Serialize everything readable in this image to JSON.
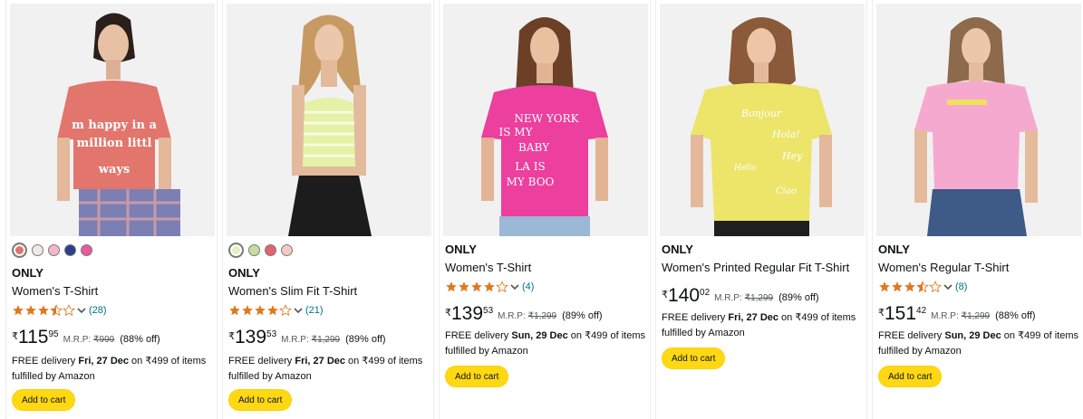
{
  "products": [
    {
      "brand": "ONLY",
      "title": "Women's T-Shirt",
      "shirt_text": [
        "m happy in a",
        "million littl",
        "ways"
      ],
      "swatches": [
        "#E0736B",
        "#F0EAE4",
        "#F2B8C6",
        "#2E3E8E",
        "#E85A9B"
      ],
      "rating_count": "(28)",
      "rating": 3.5,
      "currency": "₹",
      "price_whole": "115",
      "price_fraction": "95",
      "mrp_label": "M.R.P:",
      "mrp": "₹999",
      "discount": "(88% off)",
      "delivery_prefix": "FREE delivery ",
      "delivery_date": "Fri, 27 Dec",
      "delivery_suffix": " on ₹499 of items fulfilled by Amazon",
      "button": "Add to cart"
    },
    {
      "brand": "ONLY",
      "title": "Women's Slim Fit T-Shirt",
      "shirt_text": [],
      "swatches": [
        "#E5F0C0",
        "#C6DDA0",
        "#E2656B",
        "#F4C9C4"
      ],
      "rating_count": "(21)",
      "rating": 4,
      "currency": "₹",
      "price_whole": "139",
      "price_fraction": "53",
      "mrp_label": "M.R.P:",
      "mrp": "₹1,299",
      "discount": "(89% off)",
      "delivery_prefix": "FREE delivery ",
      "delivery_date": "Fri, 27 Dec",
      "delivery_suffix": " on ₹499 of items fulfilled by Amazon",
      "button": "Add to cart"
    },
    {
      "brand": "ONLY",
      "title": "Women's T-Shirt",
      "shirt_text": [
        "NEW  YORK",
        "IS MY",
        "BABY",
        "LA    IS",
        "MY   BOO"
      ],
      "swatches": [],
      "rating_count": "(4)",
      "rating": 4,
      "currency": "₹",
      "price_whole": "139",
      "price_fraction": "53",
      "mrp_label": "M.R.P:",
      "mrp": "₹1,299",
      "discount": "(89% off)",
      "delivery_prefix": "FREE delivery ",
      "delivery_date": "Sun, 29 Dec",
      "delivery_suffix": " on ₹499 of items fulfilled by Amazon",
      "button": "Add to cart"
    },
    {
      "brand": "ONLY",
      "title": "Women's Printed Regular Fit T-Shirt",
      "shirt_text": [
        "Bonjour",
        "Hola!",
        "Hey",
        "Hello",
        "Ciao"
      ],
      "swatches": [],
      "rating_count": "",
      "rating": 0,
      "currency": "₹",
      "price_whole": "140",
      "price_fraction": "02",
      "mrp_label": "M.R.P:",
      "mrp": "₹1,299",
      "discount": "(89% off)",
      "delivery_prefix": "FREE delivery ",
      "delivery_date": "Fri, 27 Dec",
      "delivery_suffix": " on ₹499 of items fulfilled by Amazon",
      "button": "Add to cart"
    },
    {
      "brand": "ONLY",
      "title": "Women's Regular T-Shirt",
      "shirt_text": [],
      "swatches": [],
      "rating_count": "(8)",
      "rating": 3.5,
      "currency": "₹",
      "price_whole": "151",
      "price_fraction": "42",
      "mrp_label": "M.R.P:",
      "mrp": "₹1,299",
      "discount": "(88% off)",
      "delivery_prefix": "FREE delivery ",
      "delivery_date": "Sun, 29 Dec",
      "delivery_suffix": " on ₹499 of items fulfilled by Amazon",
      "button": "Add to cart"
    }
  ],
  "colors": {
    "star": "#DE7921",
    "link": "#007185",
    "button": "#FFD814",
    "shirt_1": "#E2756C",
    "shirt_2": "#E6F1A8",
    "shirt_3": "#EC3F9E",
    "shirt_4": "#EDE46A",
    "shirt_5": "#F6A9CF"
  }
}
